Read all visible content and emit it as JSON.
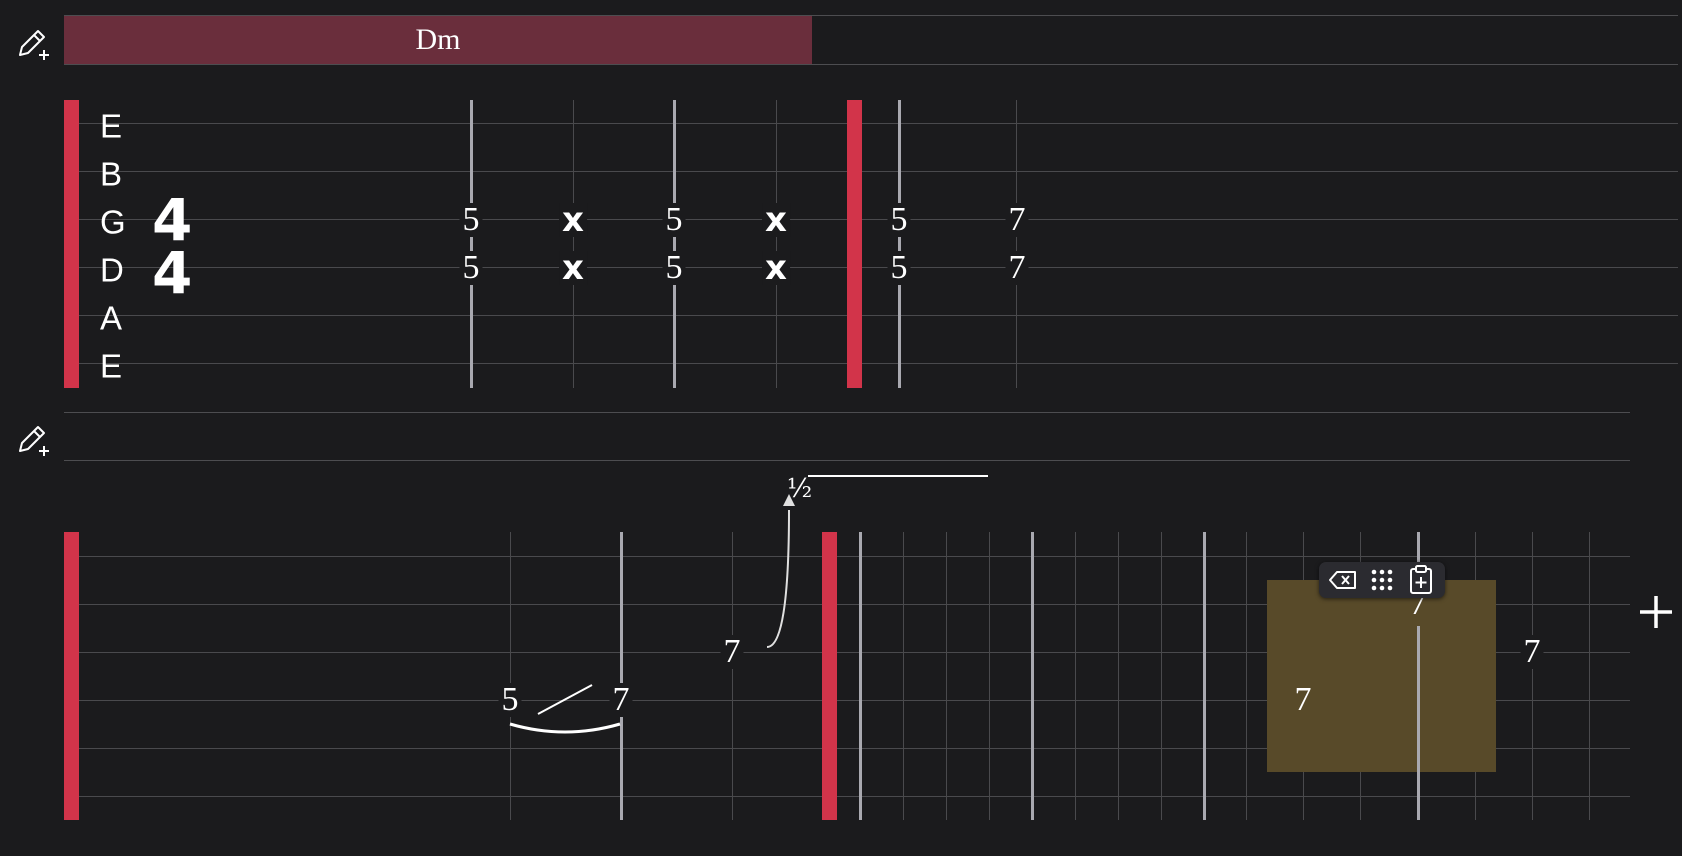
{
  "chord_track": {
    "chord_label": "Dm"
  },
  "time_signature": {
    "top": "4",
    "bottom": "4"
  },
  "strings": [
    "E",
    "B",
    "G",
    "D",
    "A",
    "E"
  ],
  "row1": {
    "notes": [
      {
        "g": "5",
        "d": "5"
      },
      {
        "g": "x",
        "d": "x"
      },
      {
        "g": "5",
        "d": "5"
      },
      {
        "g": "x",
        "d": "x"
      },
      {
        "g": "5",
        "d": "5"
      },
      {
        "g": "7",
        "d": "7"
      }
    ]
  },
  "row2": {
    "slide_from": "5",
    "slide_to": "7",
    "bend_fret": "7",
    "bend_amount": "½",
    "sel_fret_b": "7",
    "sel_fret_d": "7",
    "after_fret": "7"
  },
  "toolbar": {
    "items": [
      "delete-tag-icon",
      "grid-dots-icon",
      "clipboard-add-icon"
    ]
  },
  "colors": {
    "accent": "#d2344a",
    "chord": "#6a2e3c",
    "selection": "#584a29",
    "background": "#1b1b1d"
  }
}
